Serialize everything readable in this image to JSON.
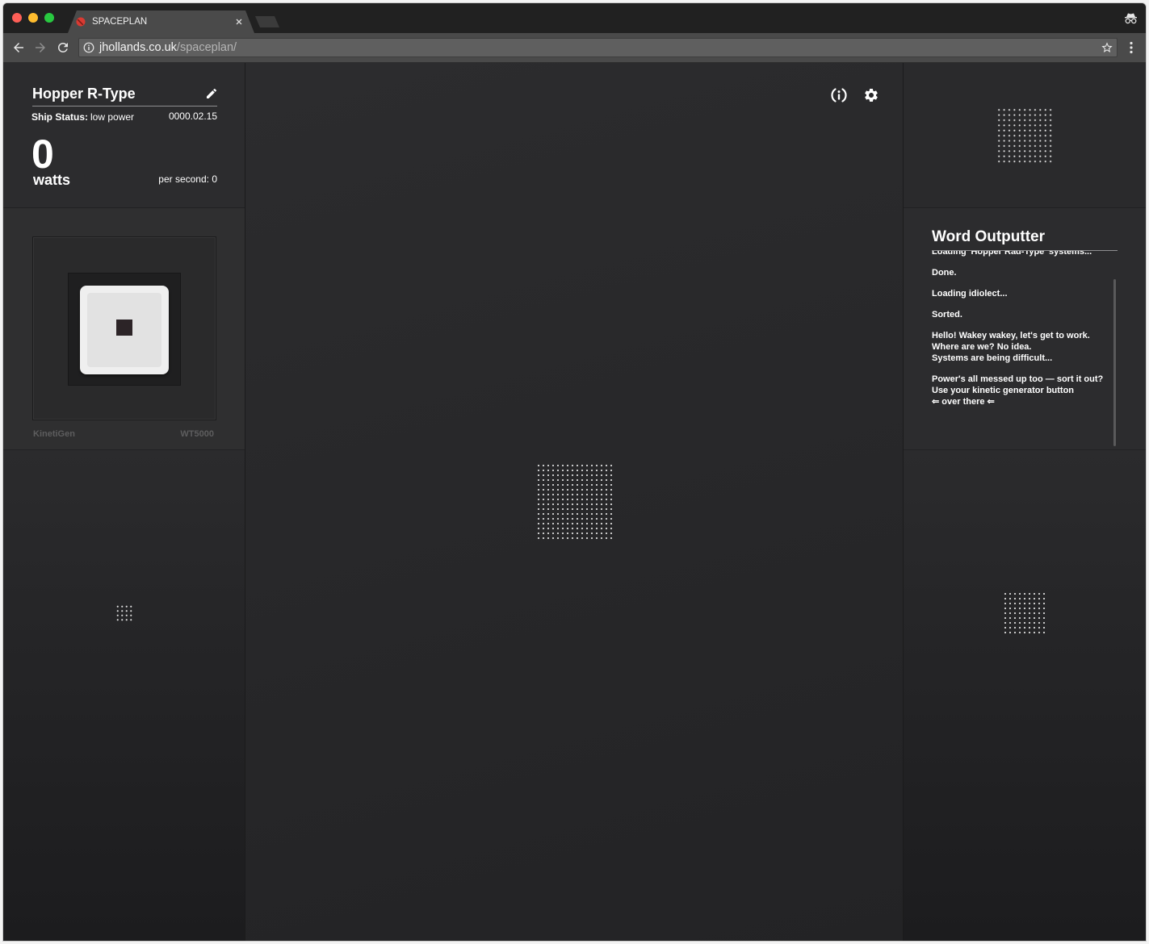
{
  "browser": {
    "tab_title": "SPACEPLAN",
    "url_host": "jhollands.co.uk",
    "url_path": "/spaceplan/"
  },
  "ship": {
    "name": "Hopper R-Type",
    "status_label": "Ship Status:",
    "status_value": "low power",
    "date": "0000.02.15",
    "power": "0",
    "power_unit": "watts",
    "per_second": "per second: 0"
  },
  "generator": {
    "name": "KinetiGen",
    "model": "WT5000"
  },
  "outputter": {
    "title": "Word Outputter",
    "messages": [
      {
        "lines": [
          "Loading 'Hopper Rad-Type' systems..."
        ]
      },
      {
        "lines": [
          "Done."
        ]
      },
      {
        "lines": [
          "Loading idiolect..."
        ]
      },
      {
        "lines": [
          "Sorted."
        ]
      },
      {
        "lines": [
          "Hello! Wakey wakey, let's get to work.",
          "Where are we? No idea.",
          "Systems are being difficult..."
        ]
      },
      {
        "lines": [
          "Power's all messed up too — sort it out?",
          "Use your kinetic generator button",
          "⇐ over there ⇐"
        ]
      }
    ]
  },
  "icons": {
    "edit": "pencil-icon",
    "about": "info-icon",
    "settings": "gear-icon",
    "back": "back-arrow-icon",
    "forward": "forward-arrow-icon",
    "reload": "reload-icon",
    "site_info": "site-info-icon",
    "bookmark": "star-icon",
    "menu": "kebab-menu-icon",
    "incognito": "incognito-icon",
    "tab_close": "close-icon"
  },
  "colors": {
    "text": "#ffffff",
    "muted_label": "#5d5d5e",
    "kinetigen_button": "#efefef",
    "kinetigen_core": "#2c2427",
    "favicon": "#d93a32",
    "url_path": "#b4b4b4",
    "traffic_close": "#fe5f57",
    "traffic_minimize": "#febc2e",
    "traffic_zoom": "#28c840"
  }
}
